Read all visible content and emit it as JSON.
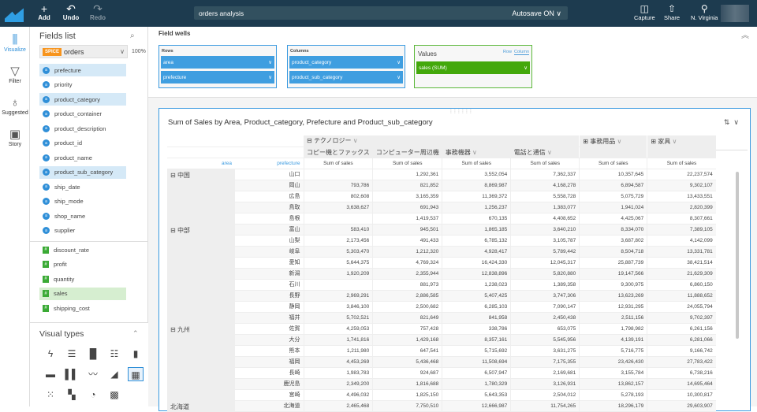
{
  "topbar": {
    "add": "Add",
    "undo": "Undo",
    "redo": "Redo",
    "analysis_title": "orders analysis",
    "autosave": "Autosave ON",
    "capture": "Capture",
    "share": "Share",
    "region": "N. Virginia"
  },
  "rail": [
    {
      "label": "Visualize",
      "icon": "bar-chart-icon"
    },
    {
      "label": "Filter",
      "icon": "filter-icon"
    },
    {
      "label": "Suggested",
      "icon": "lightbulb-icon"
    },
    {
      "label": "Story",
      "icon": "story-icon"
    }
  ],
  "fields": {
    "title": "Fields list",
    "badge": "SPICE",
    "dataset": "orders",
    "percent": "100%",
    "dimensions": [
      {
        "name": "prefecture",
        "hl": true
      },
      {
        "name": "priority"
      },
      {
        "name": "product_category",
        "hl": true
      },
      {
        "name": "product_container"
      },
      {
        "name": "product_description"
      },
      {
        "name": "product_id"
      },
      {
        "name": "product_name"
      },
      {
        "name": "product_sub_category",
        "hl": true
      },
      {
        "name": "ship_date"
      },
      {
        "name": "ship_mode"
      },
      {
        "name": "shop_name"
      },
      {
        "name": "supplier"
      }
    ],
    "measures": [
      {
        "name": "discount_rate"
      },
      {
        "name": "profit"
      },
      {
        "name": "quantity"
      },
      {
        "name": "sales",
        "hl": true
      },
      {
        "name": "shipping_cost"
      }
    ]
  },
  "visual_types": {
    "title": "Visual types",
    "selected": "pivot-table"
  },
  "field_wells": {
    "title": "Field wells",
    "rows_label": "Rows",
    "rows": [
      "area",
      "prefecture"
    ],
    "columns_label": "Columns",
    "columns": [
      "product_category",
      "product_sub_category"
    ],
    "values_label": "Values",
    "values": [
      "sales (SUM)"
    ],
    "row_opt": "Row",
    "column_opt": "Column"
  },
  "visual": {
    "title": "Sum of Sales by Area, Product_category, Prefecture and Product_sub_category",
    "categories": [
      "テクノロジー",
      "事務用品",
      "家具"
    ],
    "subcategories": [
      "コピー機とファックス",
      "コンピューター周辺機",
      "事務機器",
      "電話と通信"
    ],
    "row_fields": [
      "area",
      "prefecture"
    ],
    "measure": "Sum of sales",
    "groups": [
      {
        "area": "中国",
        "collapsible": true,
        "rows": [
          [
            "山口",
            "",
            "1,292,361",
            "3,552,054",
            "7,362,337",
            "10,357,645",
            "22,237,574"
          ],
          [
            "岡山",
            "793,786",
            "821,852",
            "8,869,987",
            "4,168,278",
            "6,894,587",
            "9,302,107"
          ],
          [
            "広島",
            "802,608",
            "3,165,359",
            "11,369,372",
            "5,558,728",
            "5,075,729",
            "13,433,551"
          ],
          [
            "鳥取",
            "3,638,627",
            "691,943",
            "1,256,237",
            "1,383,077",
            "1,941,024",
            "2,820,399"
          ],
          [
            "島根",
            "",
            "1,419,537",
            "670,135",
            "4,408,652",
            "4,425,067",
            "8,307,661"
          ]
        ]
      },
      {
        "area": "中部",
        "collapsible": true,
        "rows": [
          [
            "富山",
            "583,410",
            "945,501",
            "1,865,185",
            "3,640,210",
            "8,334,070",
            "7,389,105"
          ],
          [
            "山梨",
            "2,173,456",
            "491,433",
            "6,785,132",
            "3,105,787",
            "3,687,802",
            "4,142,099"
          ],
          [
            "岐阜",
            "5,303,470",
            "1,212,320",
            "4,928,417",
            "5,789,442",
            "8,504,718",
            "13,331,781"
          ],
          [
            "愛知",
            "5,644,375",
            "4,769,324",
            "16,424,330",
            "12,045,317",
            "25,887,739",
            "38,421,514"
          ],
          [
            "新潟",
            "1,920,209",
            "2,355,944",
            "12,838,896",
            "5,820,880",
            "19,147,566",
            "21,629,309"
          ],
          [
            "石川",
            "",
            "881,973",
            "1,238,023",
            "1,389,358",
            "9,300,975",
            "6,860,150"
          ],
          [
            "長野",
            "2,969,291",
            "2,886,585",
            "5,407,425",
            "3,747,306",
            "13,623,269",
            "11,888,652"
          ],
          [
            "静岡",
            "3,846,100",
            "2,500,682",
            "6,285,103",
            "7,090,147",
            "12,931,295",
            "24,055,794"
          ],
          [
            "福井",
            "5,702,521",
            "821,649",
            "841,958",
            "2,450,438",
            "2,511,156",
            "9,702,397"
          ]
        ]
      },
      {
        "area": "九州",
        "collapsible": true,
        "rows": [
          [
            "佐賀",
            "4,259,053",
            "757,428",
            "338,786",
            "653,075",
            "1,798,982",
            "6,261,156"
          ],
          [
            "大分",
            "1,741,816",
            "1,429,168",
            "8,357,161",
            "5,545,956",
            "4,139,191",
            "6,281,066"
          ],
          [
            "熊本",
            "1,211,980",
            "647,541",
            "5,715,692",
            "3,631,275",
            "5,716,775",
            "9,166,742"
          ],
          [
            "福岡",
            "4,453,269",
            "5,436,468",
            "11,508,694",
            "7,175,355",
            "23,426,430",
            "27,783,422"
          ],
          [
            "長崎",
            "1,983,783",
            "924,687",
            "6,507,947",
            "2,169,681",
            "3,155,784",
            "6,738,216"
          ],
          [
            "鹿児島",
            "2,349,200",
            "1,816,688",
            "1,780,329",
            "3,126,931",
            "13,862,157",
            "14,695,464"
          ],
          [
            "宮崎",
            "4,496,032",
            "1,825,150",
            "5,643,353",
            "2,504,012",
            "5,278,193",
            "10,300,817"
          ]
        ]
      },
      {
        "area": "北海道",
        "collapsible": false,
        "rows": [
          [
            "北海道",
            "2,465,468",
            "7,750,510",
            "12,666,987",
            "11,754,265",
            "18,296,179",
            "29,603,907"
          ]
        ]
      }
    ]
  },
  "colors": {
    "topbar": "#1d3b4f",
    "accent": "#3a9ae0",
    "dimension_pill": "#3f9ee0",
    "measure_pill": "#43a80b",
    "spice": "#f7941d"
  }
}
